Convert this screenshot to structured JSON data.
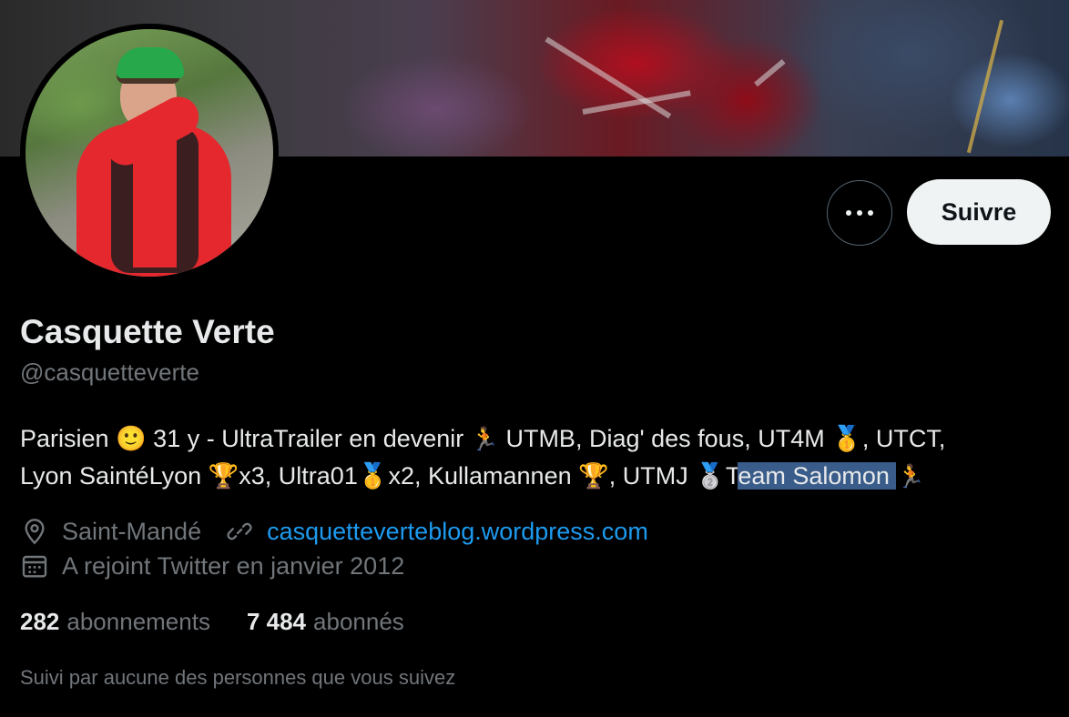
{
  "profile": {
    "name": "Casquette Verte",
    "handle": "@casquetteverte",
    "bio_line1": {
      "a": "Parisien ",
      "b": " 31 y - UltraTrailer en devenir ",
      "c": " UTMB, Diag' des fous, UT4M ",
      "d": ", UTCT,"
    },
    "bio_line2": {
      "a": "Lyon SaintéLyon ",
      "b": "x3, Ultra01",
      "c": "x2, Kullamannen ",
      "d": ", UTMJ ",
      "e": "T",
      "f": "eam Salomon ",
      "g": " "
    },
    "emojis": {
      "smile": "🙂",
      "runner": "🏃",
      "medal_gold": "🥇",
      "medal_silver": "🥈",
      "trophy": "🏆"
    },
    "location": "Saint-Mandé",
    "website": "casquetteverteblog.wordpress.com",
    "joined": "A rejoint Twitter en janvier 2012",
    "following_count": "282",
    "following_label": "abonnements",
    "followers_count": "7 484",
    "followers_label": "abonnés",
    "followed_by": "Suivi par aucune des personnes que vous suivez"
  },
  "actions": {
    "follow_label": "Suivre",
    "more_label": "···"
  },
  "colors": {
    "background": "#000000",
    "text": "#e7e9ea",
    "secondary": "#71767b",
    "link": "#1d9bf0",
    "follow_button_bg": "#eff3f4"
  }
}
